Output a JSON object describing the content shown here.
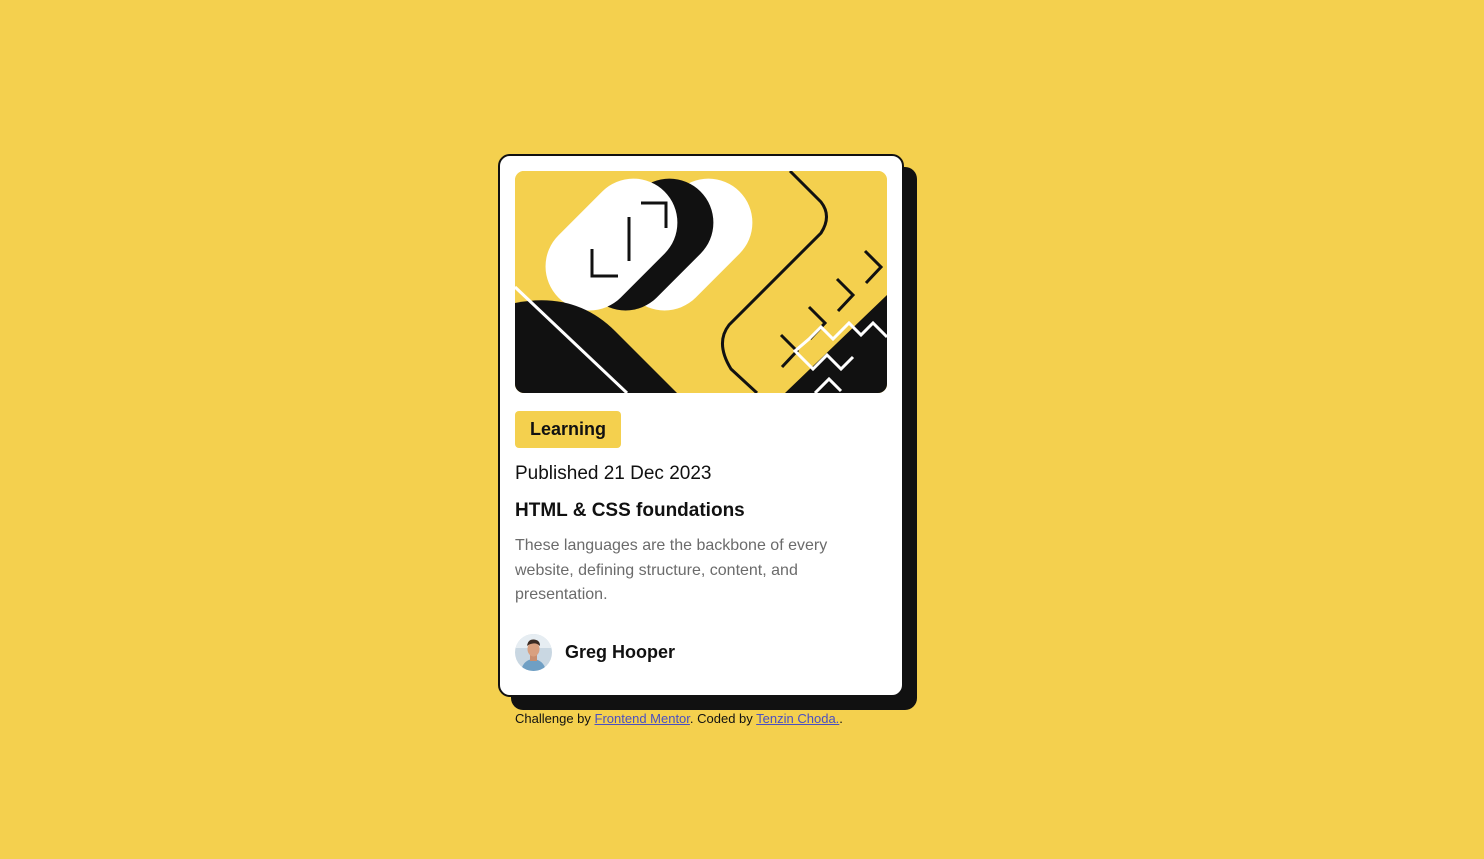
{
  "card": {
    "hero_image": "illustration-article",
    "category": "Learning",
    "published": "Published 21 Dec 2023",
    "title": "HTML & CSS foundations",
    "description": "These languages are the backbone of every website, defining structure, content, and presentation.",
    "author": {
      "name": "Greg Hooper",
      "avatar": "avatar-photo"
    }
  },
  "attribution": {
    "prefix": "Challenge by",
    "challenge_link": "Frontend Mentor",
    "middle": ". Coded by",
    "author_link": "Tenzin Choda.",
    "suffix": "."
  },
  "colors": {
    "background": "#f4d04e",
    "card": "#ffffff",
    "ink": "#111111",
    "muted_text": "#6b6b6b",
    "link": "#4a4fc2"
  }
}
